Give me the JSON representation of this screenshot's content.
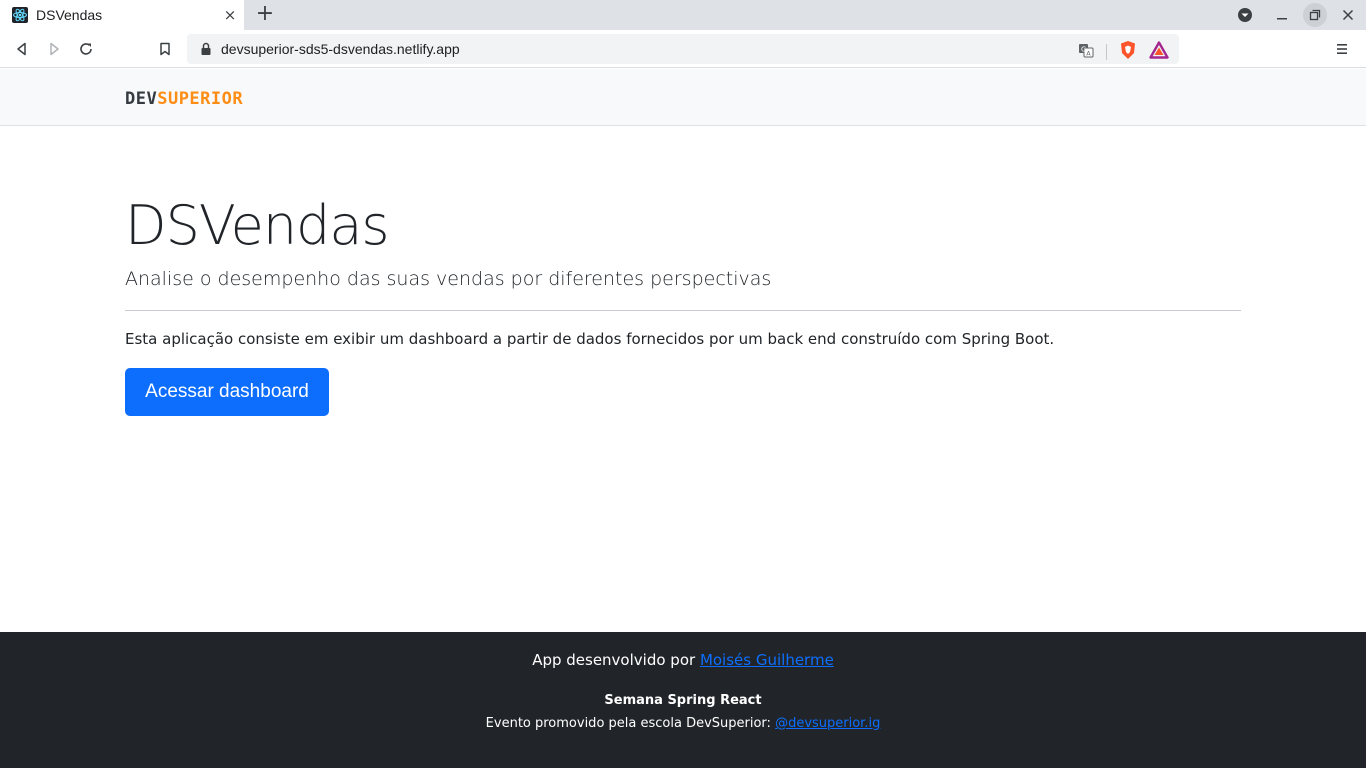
{
  "browser": {
    "tab_title": "DSVendas",
    "tab_close": "×",
    "new_tab": "+",
    "url": "devsuperior-sds5-dsvendas.netlify.app",
    "icons": [
      "react-favicon-icon",
      "back-icon",
      "forward-icon",
      "reload-icon",
      "bookmark-icon",
      "lock-icon",
      "translate-icon",
      "brave-shield-icon",
      "brave-rewards-icon",
      "menu-icon",
      "profile-dropdown-icon",
      "minimize-icon",
      "restore-icon",
      "close-window-icon"
    ]
  },
  "header": {
    "logo_dev": "DEV",
    "logo_superior": "SUPERIOR"
  },
  "main": {
    "title": "DSVendas",
    "lead": "Analise o desempenho das suas vendas por diferentes perspectivas",
    "description": "Esta aplicação consiste em exibir um dashboard a partir de dados fornecidos por um back end construído com Spring Boot.",
    "button_label": "Acessar dashboard"
  },
  "footer": {
    "line1_text": "App desenvolvido por ",
    "line1_link": "Moisés Guilherme",
    "line2": "Semana Spring React",
    "line3_text": "Evento promovido pela escola DevSuperior: ",
    "line3_link": "@devsuperior.ig"
  },
  "colors": {
    "accent": "#0d6efd",
    "logo_orange": "#fd8d15",
    "footer_bg": "#212529"
  }
}
